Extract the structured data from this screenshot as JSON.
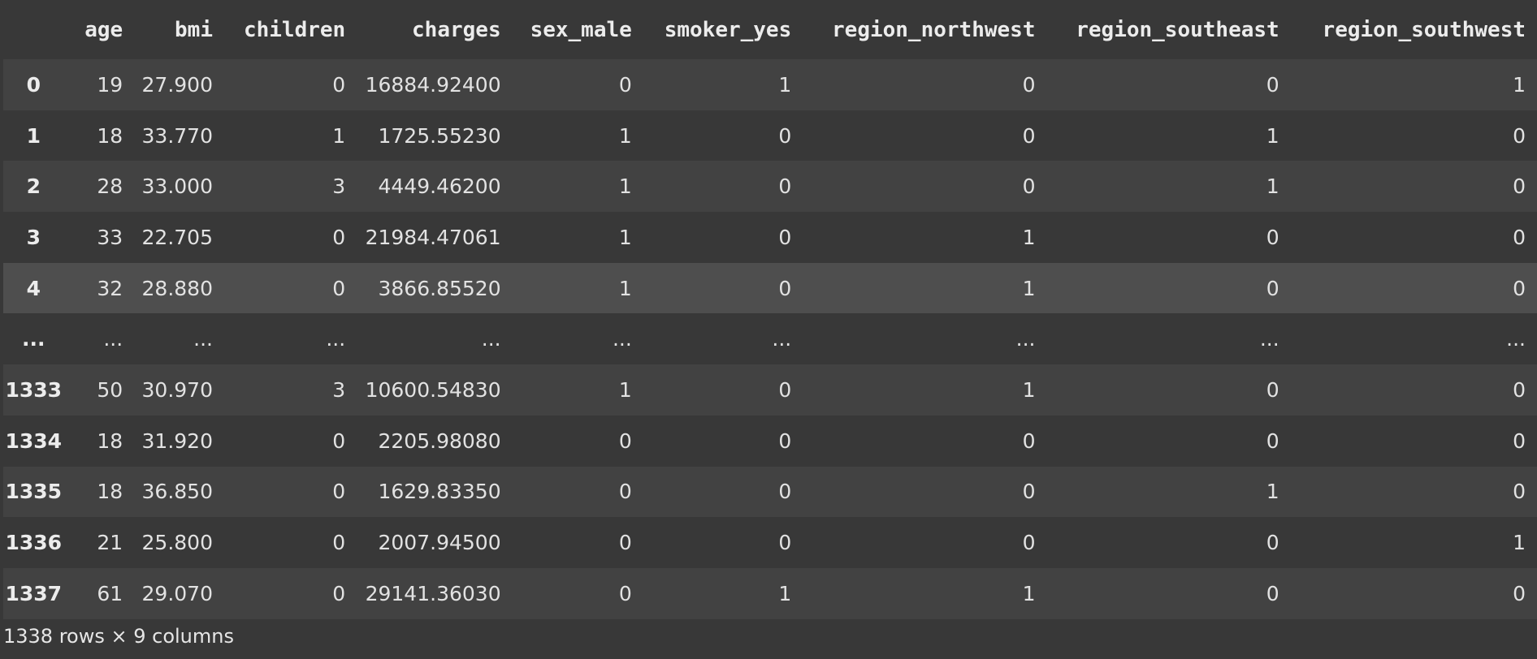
{
  "table": {
    "columns": [
      "",
      "age",
      "bmi",
      "children",
      "charges",
      "sex_male",
      "smoker_yes",
      "region_northwest",
      "region_southeast",
      "region_southwest"
    ],
    "rows": [
      [
        "0",
        "19",
        "27.900",
        "0",
        "16884.92400",
        "0",
        "1",
        "0",
        "0",
        "1"
      ],
      [
        "1",
        "18",
        "33.770",
        "1",
        "1725.55230",
        "1",
        "0",
        "0",
        "1",
        "0"
      ],
      [
        "2",
        "28",
        "33.000",
        "3",
        "4449.46200",
        "1",
        "0",
        "0",
        "1",
        "0"
      ],
      [
        "3",
        "33",
        "22.705",
        "0",
        "21984.47061",
        "1",
        "0",
        "1",
        "0",
        "0"
      ],
      [
        "4",
        "32",
        "28.880",
        "0",
        "3866.85520",
        "1",
        "0",
        "1",
        "0",
        "0"
      ],
      [
        "...",
        "...",
        "...",
        "...",
        "...",
        "...",
        "...",
        "...",
        "...",
        "..."
      ],
      [
        "1333",
        "50",
        "30.970",
        "3",
        "10600.54830",
        "1",
        "0",
        "1",
        "0",
        "0"
      ],
      [
        "1334",
        "18",
        "31.920",
        "0",
        "2205.98080",
        "0",
        "0",
        "0",
        "0",
        "0"
      ],
      [
        "1335",
        "18",
        "36.850",
        "0",
        "1629.83350",
        "0",
        "0",
        "0",
        "1",
        "0"
      ],
      [
        "1336",
        "21",
        "25.800",
        "0",
        "2007.94500",
        "0",
        "0",
        "0",
        "0",
        "1"
      ],
      [
        "1337",
        "61",
        "29.070",
        "0",
        "29141.36030",
        "0",
        "1",
        "1",
        "0",
        "0"
      ]
    ],
    "footer": "1338 rows × 9 columns"
  },
  "colors": {
    "background": "#383838",
    "row_alt": "#424242",
    "row_hover": "#4e4e4e",
    "text": "#e6e6e6"
  }
}
